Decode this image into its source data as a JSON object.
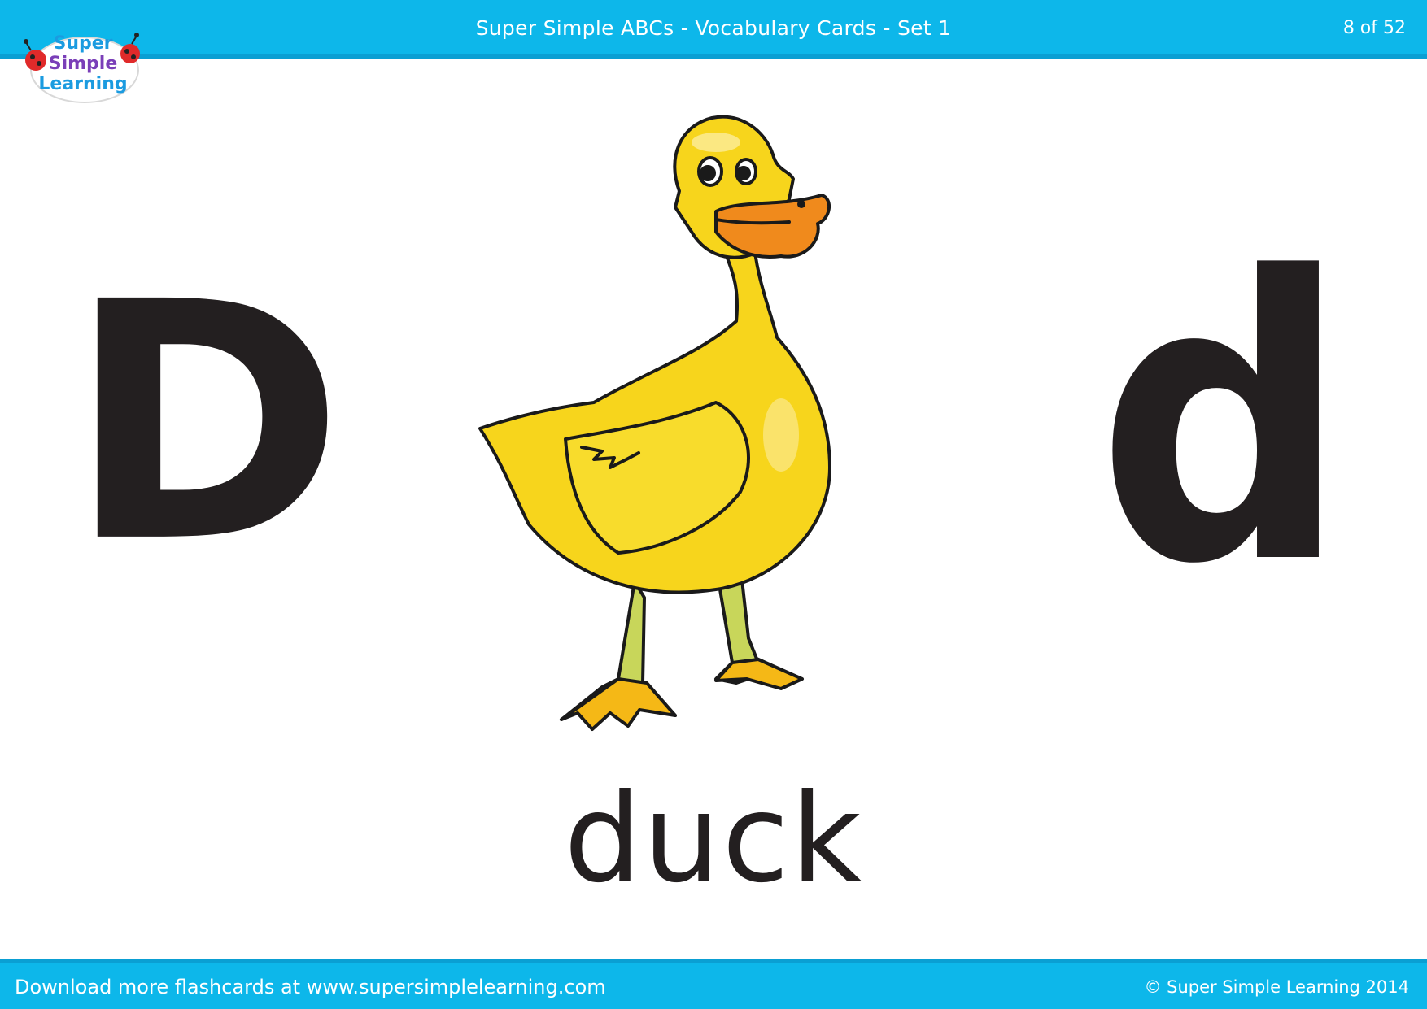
{
  "header": {
    "title": "Super Simple ABCs - Vocabulary Cards - Set 1",
    "page_indicator": "8 of 52"
  },
  "logo": {
    "line1": "Super",
    "line2": "Simple",
    "line3": "Learning"
  },
  "card": {
    "uppercase_letter": "D",
    "lowercase_letter": "d",
    "word": "duck",
    "image_icon": "duck-illustration"
  },
  "footer": {
    "download_text": "Download more flashcards at www.supersimplelearning.com",
    "copyright": "© Super Simple Learning 2014"
  },
  "colors": {
    "brand_blue": "#0db7ea",
    "letter_black": "#231f20",
    "duck_yellow": "#f7d51c",
    "beak_orange": "#f08a1c"
  }
}
